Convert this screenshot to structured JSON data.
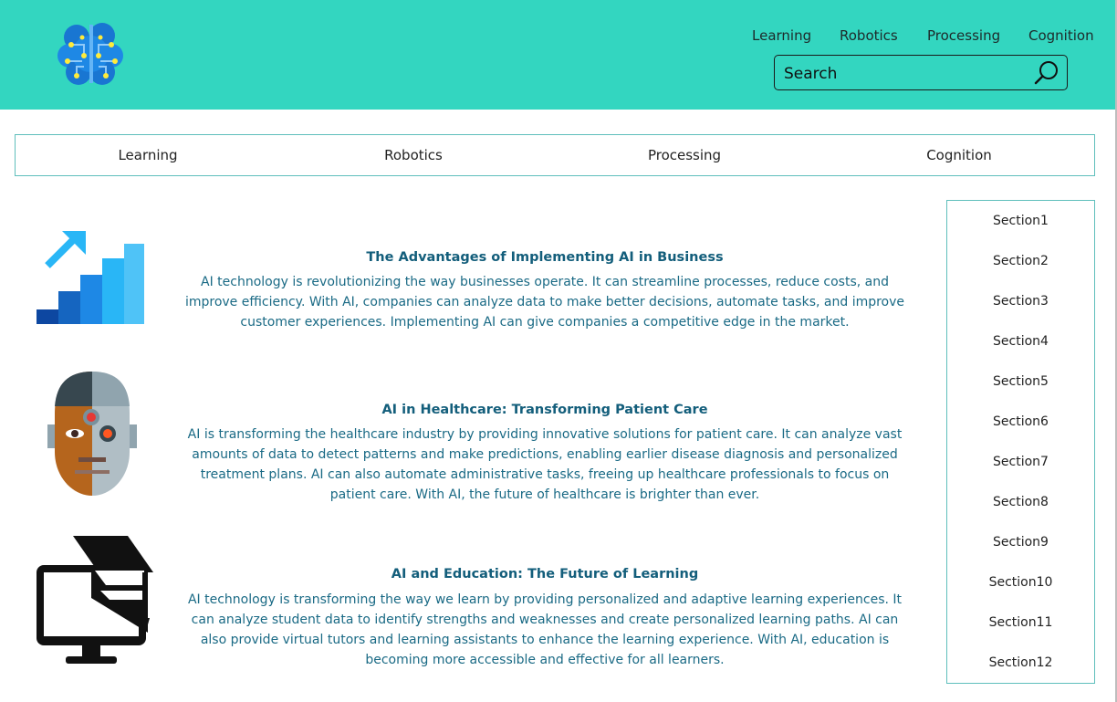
{
  "header": {
    "logo_icon": "brain-circuit-icon",
    "nav": [
      "Learning",
      "Robotics",
      "Processing",
      "Cognition"
    ],
    "search": {
      "placeholder": "Search",
      "icon": "search-icon"
    }
  },
  "sub_nav": [
    "Learning",
    "Robotics",
    "Processing",
    "Cognition"
  ],
  "articles": [
    {
      "icon": "growth-chart-icon",
      "title": "The Advantages of Implementing AI in Business",
      "body": "AI technology is revolutionizing the way businesses operate. It can streamline processes, reduce costs, and improve efficiency. With AI, companies can analyze data to make better decisions, automate tasks, and improve customer experiences. Implementing AI can give companies a competitive edge in the market."
    },
    {
      "icon": "cyborg-face-icon",
      "title": "AI in Healthcare: Transforming Patient Care",
      "body": "AI is transforming the healthcare industry by providing innovative solutions for patient care. It can analyze vast amounts of data to detect patterns and make predictions, enabling earlier disease diagnosis and personalized treatment plans. AI can also automate administrative tasks, freeing up healthcare professionals to focus on patient care. With AI, the future of healthcare is brighter than ever."
    },
    {
      "icon": "graduation-monitor-icon",
      "title": "AI and Education: The Future of Learning",
      "body": "AI technology is transforming the way we learn by providing personalized and adaptive learning experiences. It can analyze student data to identify strengths and weaknesses and create personalized learning paths. AI can also provide virtual tutors and learning assistants to enhance the learning experience. With AI, education is becoming more accessible and effective for all learners."
    }
  ],
  "sidebar": [
    "Section1",
    "Section2",
    "Section3",
    "Section4",
    "Section5",
    "Section6",
    "Section7",
    "Section8",
    "Section9",
    "Section10",
    "Section11",
    "Section12"
  ],
  "colors": {
    "header_bg": "#33d6c0",
    "accent_border": "#5fbfbc",
    "title": "#135e7b",
    "body_text": "#1a6a85"
  }
}
